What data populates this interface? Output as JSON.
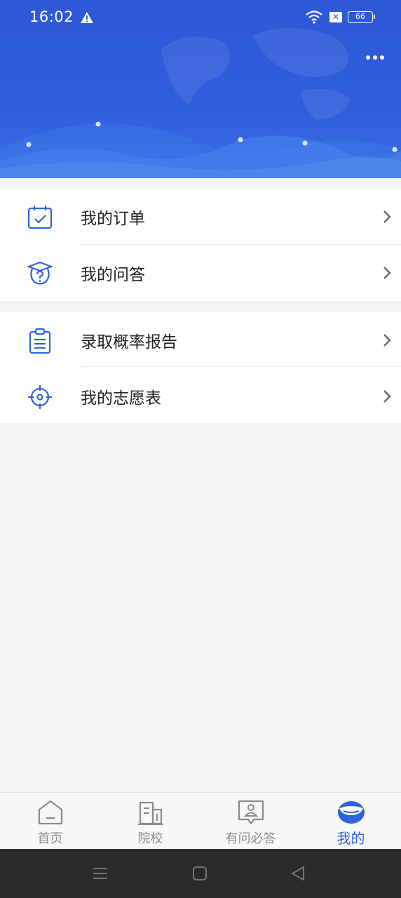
{
  "status_bar": {
    "time": "16:02",
    "battery": "66",
    "x_badge": "✕"
  },
  "header": {
    "more_icon": "more-dots-icon"
  },
  "menu": {
    "group1": [
      {
        "label": "我的订单",
        "icon": "calendar-check-icon"
      },
      {
        "label": "我的问答",
        "icon": "graduation-question-icon"
      }
    ],
    "group2": [
      {
        "label": "录取概率报告",
        "icon": "clipboard-report-icon"
      },
      {
        "label": "我的志愿表",
        "icon": "target-icon"
      }
    ]
  },
  "tabs": [
    {
      "label": "首页",
      "icon": "home-icon",
      "active": false
    },
    {
      "label": "院校",
      "icon": "school-building-icon",
      "active": false
    },
    {
      "label": "有问必答",
      "icon": "qa-chat-person-icon",
      "active": false
    },
    {
      "label": "我的",
      "icon": "my-profile-icon",
      "active": true
    }
  ],
  "colors": {
    "accent": "#2f63d9",
    "header": "#2f5ede",
    "text": "#222222",
    "inactive": "#8a8a8a"
  }
}
